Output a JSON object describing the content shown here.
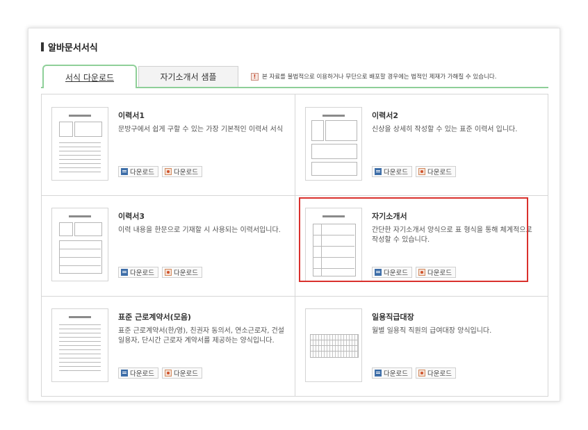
{
  "section_title": "알바문서서식",
  "tabs": [
    {
      "label": "서식 다운로드",
      "active": true
    },
    {
      "label": "자기소개서 샘플",
      "active": false
    }
  ],
  "notice": {
    "icon": "!",
    "text": "본 자료를 불법적으로 이용하거나 무단으로 배포할 경우에는 법적인 제재가 가해질 수 있습니다."
  },
  "download_label": "다운로드",
  "items": [
    {
      "title": "이력서1",
      "desc": "문방구에서 쉽게 구할 수 있는 가장 기본적인 이력서 서식"
    },
    {
      "title": "이력서2",
      "desc": "신상을 상세히 작성할 수 있는 표준 이력서 입니다."
    },
    {
      "title": "이력서3",
      "desc": "이력 내용을 한문으로 기재할 시 사용되는 이력서입니다."
    },
    {
      "title": "자기소개서",
      "desc": "간단한 자기소개서 양식으로 표 형식을 통해 체계적으로 작성할 수 있습니다."
    },
    {
      "title": "표준 근로계약서(모음)",
      "desc": "표준 근로계약서(한/영), 친권자 동의서, 연소근로자, 건설 일용자, 단시간 근로자 계약서를 제공하는 양식입니다."
    },
    {
      "title": "일용직급대장",
      "desc": "월별 일용직 직원의 급여대장 양식입니다."
    }
  ],
  "colors": {
    "tab_accent": "#8ecf98",
    "highlight": "#d9302c",
    "doc_icon": "#3e6ea8",
    "hwp_icon": "#d0522a"
  }
}
